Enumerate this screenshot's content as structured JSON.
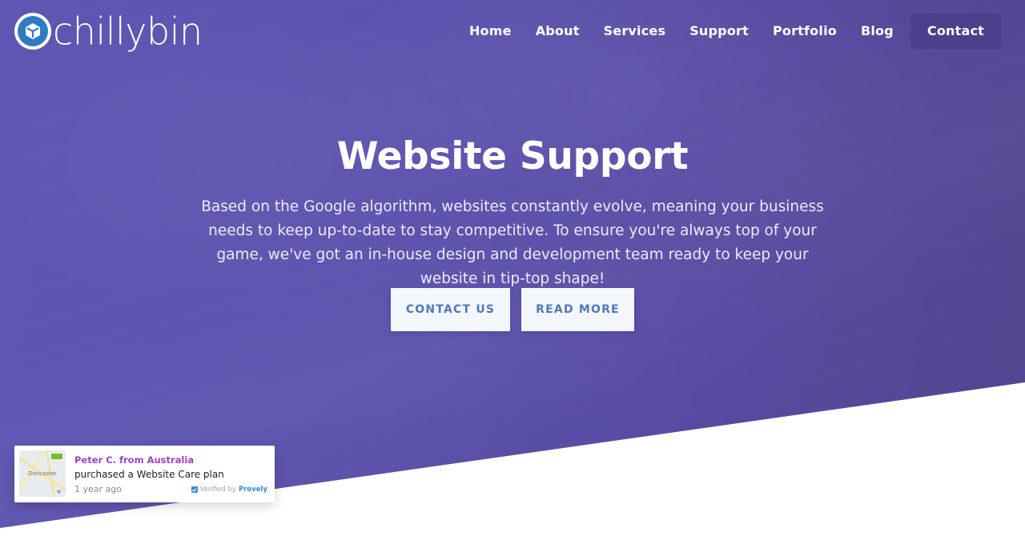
{
  "brand": {
    "name": "chillybin",
    "icon": "cube-logo-icon",
    "colors": {
      "icon_circle": "#2f7cc2",
      "hero_bg": "#5c52ad",
      "button_text": "#4e7ab8"
    }
  },
  "nav": {
    "items": [
      {
        "label": "Home"
      },
      {
        "label": "About"
      },
      {
        "label": "Services"
      },
      {
        "label": "Support"
      },
      {
        "label": "Portfolio"
      },
      {
        "label": "Blog"
      },
      {
        "label": "Contact",
        "highlighted": true
      }
    ]
  },
  "hero": {
    "title": "Website Support",
    "paragraph": "Based on the Google algorithm, websites constantly evolve, meaning your business needs to keep up-to-date to stay competitive. To ensure you're always top of your game, we've got an in-house design and development team ready to keep your website in tip-top shape!",
    "buttons": {
      "contact": "CONTACT US",
      "read_more": "READ MORE"
    }
  },
  "notification": {
    "map_label": "Doncaster",
    "name": "Peter C. from Australia",
    "action": "purchased a Website Care plan",
    "time": "1 year ago",
    "verified_prefix": "Verified by",
    "verified_brand": "Provely",
    "colors": {
      "name": "#a040c4",
      "brand": "#2d8ad6"
    }
  }
}
